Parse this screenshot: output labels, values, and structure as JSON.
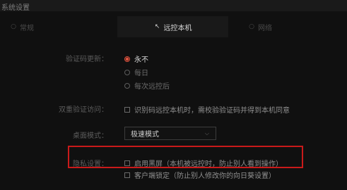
{
  "window": {
    "title": "系统设置"
  },
  "tabs": [
    {
      "label": "常规",
      "icon": "circle-settings-icon"
    },
    {
      "label": "远控本机",
      "icon": "remote-arrow-icon"
    },
    {
      "label": "网络",
      "icon": "circle-network-icon"
    }
  ],
  "verification": {
    "label": "验证码更新：",
    "options": [
      "永不",
      "每日",
      "每次远控后"
    ],
    "selected": "永不"
  },
  "two_factor": {
    "label": "双重验证访问：",
    "checkbox": "识别码远控本机时，需校验验证码并得到本机同意"
  },
  "desktop_mode": {
    "label": "桌面模式：",
    "value": "极速模式"
  },
  "privacy": {
    "label": "隐私设置：",
    "option1": "启用黑屏（本机被远控时，防止别人看到操作）",
    "option2": "客户端锁定（防止别人修改你的向日葵设置）"
  },
  "colors": {
    "accent": "#e0533e",
    "highlight": "#c91a1a"
  }
}
